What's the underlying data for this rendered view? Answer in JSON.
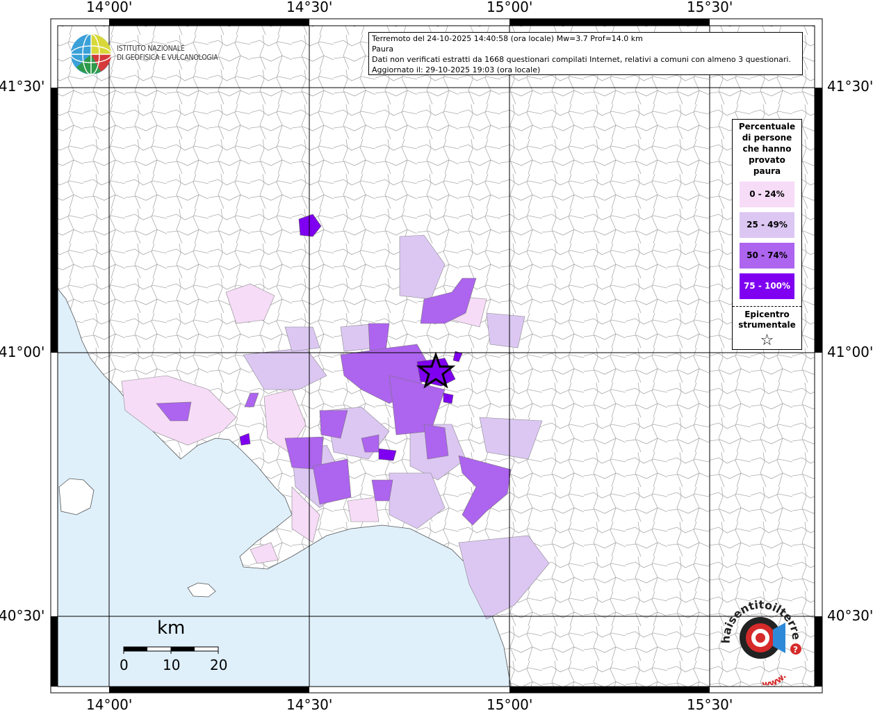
{
  "header": {
    "line1": "Terremoto del 24-10-2025 14:40:58 (ora locale) Mw=3.7 Prof=14.0 km",
    "line2": "Paura",
    "line3": "Dati non verificati estratti da 1668 questionari compilati Internet, relativi a comuni con almeno 3 questionari.",
    "line4": "Aggiornato il: 29-10-2025 19:03 (ora locale)"
  },
  "logo_ingv": {
    "line1": "ISTITUTO NAZIONALE",
    "line2": "DI GEOFISICA E VULCANOLOGIA"
  },
  "axes": {
    "lon_top": [
      "14°00'",
      "14°30'",
      "15°00'",
      "15°30'"
    ],
    "lon_bottom": [
      "14°00'",
      "14°30'",
      "15°00'",
      "15°30'"
    ],
    "lat_left": [
      "41°30'",
      "41°00'",
      "40°30'"
    ],
    "lat_right": [
      "41°30'",
      "41°00'",
      "40°30'"
    ]
  },
  "legend": {
    "title": "Percentuale di persone che hanno provato paura",
    "classes": [
      {
        "label": "0 - 24%",
        "color": "#f6dcf7"
      },
      {
        "label": "25 - 49%",
        "color": "#dcc7f3"
      },
      {
        "label": "50 - 74%",
        "color": "#ad64ee"
      },
      {
        "label": "75 - 100%",
        "color": "#7f00f0"
      }
    ],
    "epicentre_label": "Epicentro strumentale",
    "epicentre_symbol": "☆"
  },
  "scale_bar": {
    "unit": "km",
    "ticks": [
      "0",
      "10",
      "20"
    ]
  },
  "logo_hsit": {
    "text": "haisentitoilterremoto.it",
    "url_text": "www."
  },
  "colors": {
    "sea": "#dff0fb",
    "land": "#ffffff",
    "borders": "#999999",
    "grid": "#000000"
  }
}
